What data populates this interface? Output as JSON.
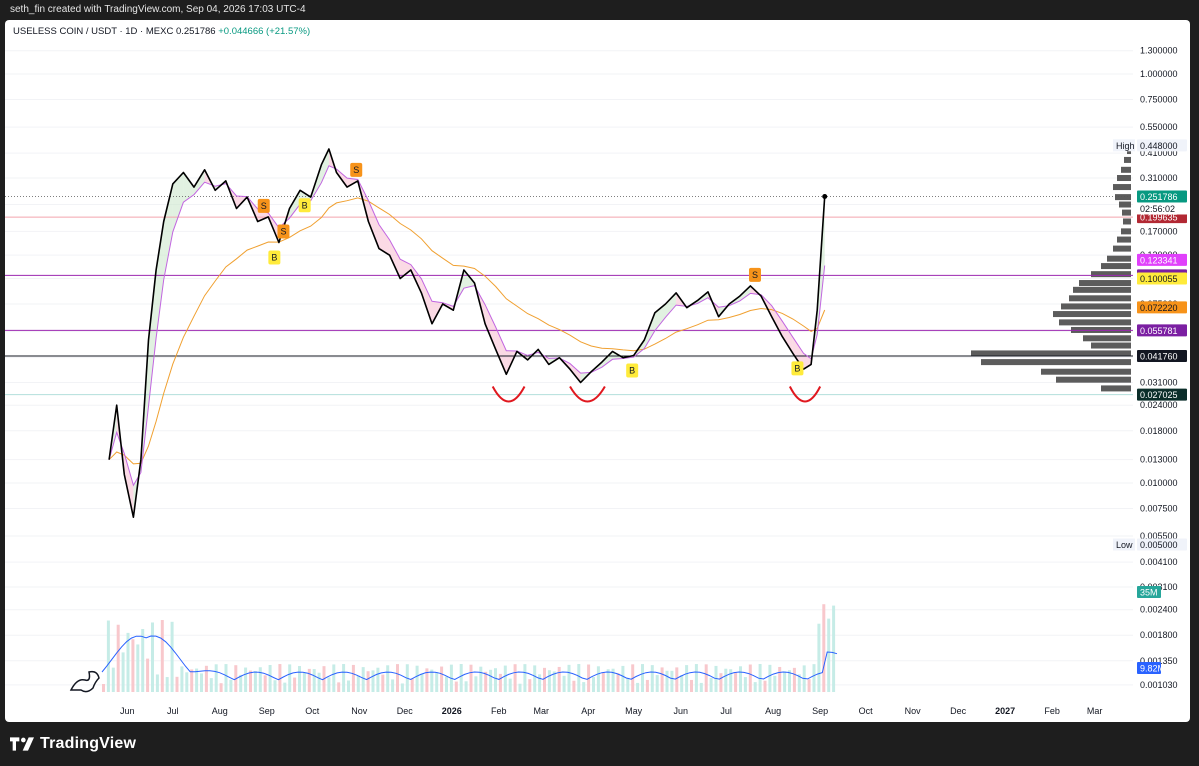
{
  "header": {
    "attribution": "seth_fin created with TradingView.com, Sep 04, 2026 17:03 UTC-4"
  },
  "symbol": {
    "pair": "USELESS COIN / USDT · 1D · MEXC",
    "last": "0.251786",
    "change": "+0.044666 (+21.57%)"
  },
  "footer": {
    "brand": "TradingView"
  },
  "colors": {
    "up": "#089981",
    "down": "#f23645",
    "price_line": "#000000",
    "ema_fast": "#c266e0",
    "ema_slow": "#f0a030",
    "volume_ma": "#2962ff"
  },
  "chart_data": {
    "type": "line",
    "scale": "log",
    "x_ticks": [
      "Jun",
      "Jul",
      "Aug",
      "Sep",
      "Oct",
      "Nov",
      "Dec",
      "2026",
      "Feb",
      "Mar",
      "Apr",
      "May",
      "Jun",
      "Jul",
      "Aug",
      "Sep",
      "Oct",
      "Nov",
      "Dec",
      "2027",
      "Feb",
      "Mar"
    ],
    "y_ticks": [
      "1.300000",
      "1.000000",
      "0.750000",
      "0.550000",
      "0.410000",
      "0.310000",
      "0.230000",
      "0.170000",
      "0.130000",
      "0.100000",
      "0.075000",
      "0.055000",
      "0.041000",
      "0.031000",
      "0.024000",
      "0.018000",
      "0.013000",
      "0.010000",
      "0.007500",
      "0.005500",
      "0.004100",
      "0.003100",
      "0.002400",
      "0.001800",
      "0.001350",
      "0.001030"
    ],
    "ylim": [
      0.00095,
      1.5
    ],
    "price_series": {
      "x": [
        "2025-05-20",
        "2025-05-25",
        "2025-05-30",
        "2025-06-05",
        "2025-06-10",
        "2025-06-15",
        "2025-06-20",
        "2025-06-25",
        "2025-07-01",
        "2025-07-08",
        "2025-07-15",
        "2025-07-22",
        "2025-07-29",
        "2025-08-05",
        "2025-08-12",
        "2025-08-19",
        "2025-08-26",
        "2025-09-02",
        "2025-09-09",
        "2025-09-16",
        "2025-09-23",
        "2025-09-30",
        "2025-10-07",
        "2025-10-12",
        "2025-10-17",
        "2025-10-24",
        "2025-10-31",
        "2025-11-07",
        "2025-11-14",
        "2025-11-21",
        "2025-11-28",
        "2025-12-05",
        "2025-12-12",
        "2025-12-19",
        "2025-12-26",
        "2026-01-02",
        "2026-01-09",
        "2026-01-16",
        "2026-01-23",
        "2026-01-30",
        "2026-02-06",
        "2026-02-13",
        "2026-02-20",
        "2026-02-27",
        "2026-03-06",
        "2026-03-13",
        "2026-03-20",
        "2026-03-27",
        "2026-04-03",
        "2026-04-10",
        "2026-04-17",
        "2026-04-24",
        "2026-05-01",
        "2026-05-08",
        "2026-05-15",
        "2026-05-22",
        "2026-05-29",
        "2026-06-05",
        "2026-06-12",
        "2026-06-19",
        "2026-06-26",
        "2026-07-03",
        "2026-07-10",
        "2026-07-17",
        "2026-07-24",
        "2026-07-31",
        "2026-08-07",
        "2026-08-14",
        "2026-08-21",
        "2026-08-26",
        "2026-08-30",
        "2026-09-04"
      ],
      "close": [
        0.013,
        0.024,
        0.011,
        0.0068,
        0.013,
        0.05,
        0.11,
        0.19,
        0.29,
        0.33,
        0.28,
        0.34,
        0.27,
        0.3,
        0.22,
        0.25,
        0.19,
        0.2,
        0.15,
        0.22,
        0.27,
        0.25,
        0.36,
        0.43,
        0.33,
        0.28,
        0.3,
        0.19,
        0.14,
        0.13,
        0.1,
        0.11,
        0.085,
        0.06,
        0.075,
        0.07,
        0.11,
        0.095,
        0.06,
        0.045,
        0.034,
        0.044,
        0.04,
        0.045,
        0.038,
        0.041,
        0.036,
        0.031,
        0.035,
        0.039,
        0.044,
        0.041,
        0.042,
        0.05,
        0.068,
        0.075,
        0.085,
        0.072,
        0.078,
        0.086,
        0.065,
        0.075,
        0.082,
        0.092,
        0.082,
        0.065,
        0.052,
        0.043,
        0.036,
        0.038,
        0.07,
        0.251786
      ]
    },
    "levels": [
      {
        "value": 0.448,
        "label": "0.448000",
        "tag": "High",
        "color": "#f0f3fa",
        "text": "#131722"
      },
      {
        "value": 0.251786,
        "label": "0.251786",
        "color": "#089981",
        "text": "#ffffff"
      },
      {
        "value": 0.199635,
        "label": "0.199635",
        "color": "#b22833",
        "text": "#ffffff",
        "line": "#f3a5ad"
      },
      {
        "value": 0.123341,
        "label": "0.123341",
        "color": "#e040fb",
        "text": "#ffffff"
      },
      {
        "value": 0.103569,
        "label": "0.103569",
        "color": "#7b1fa2",
        "text": "#ffffff",
        "line": "#9c27b0"
      },
      {
        "value": 0.100055,
        "label": "0.100055",
        "color": "#ffeb3b",
        "text": "#131722"
      },
      {
        "value": 0.07222,
        "label": "0.072220",
        "color": "#f7931a",
        "text": "#131722"
      },
      {
        "value": 0.055781,
        "label": "0.055781",
        "color": "#7b1fa2",
        "text": "#ffffff",
        "line": "#9c27b0"
      },
      {
        "value": 0.04176,
        "label": "0.041760",
        "color": "#131722",
        "text": "#ffffff",
        "line": "#131722"
      },
      {
        "value": 0.027025,
        "label": "0.027025",
        "color": "#0b2e2a",
        "text": "#ffffff",
        "line": "#b2dfdb"
      },
      {
        "value": 0.005,
        "label": "0.005000",
        "tag": "Low",
        "color": "#f0f3fa",
        "text": "#131722"
      }
    ],
    "countdown": "02:56:02",
    "volume_labels": [
      {
        "label": "35M",
        "color": "#26a69a"
      },
      {
        "label": "9.82M",
        "color": "#2962ff"
      }
    ],
    "signals": [
      {
        "type": "S",
        "x": "2025-08-30"
      },
      {
        "type": "B",
        "x": "2025-09-06"
      },
      {
        "type": "S",
        "x": "2025-09-12"
      },
      {
        "type": "B",
        "x": "2025-09-26"
      },
      {
        "type": "S",
        "x": "2025-10-30"
      },
      {
        "type": "B",
        "x": "2026-04-30"
      },
      {
        "type": "S",
        "x": "2026-07-20"
      },
      {
        "type": "B",
        "x": "2026-08-17"
      }
    ]
  }
}
